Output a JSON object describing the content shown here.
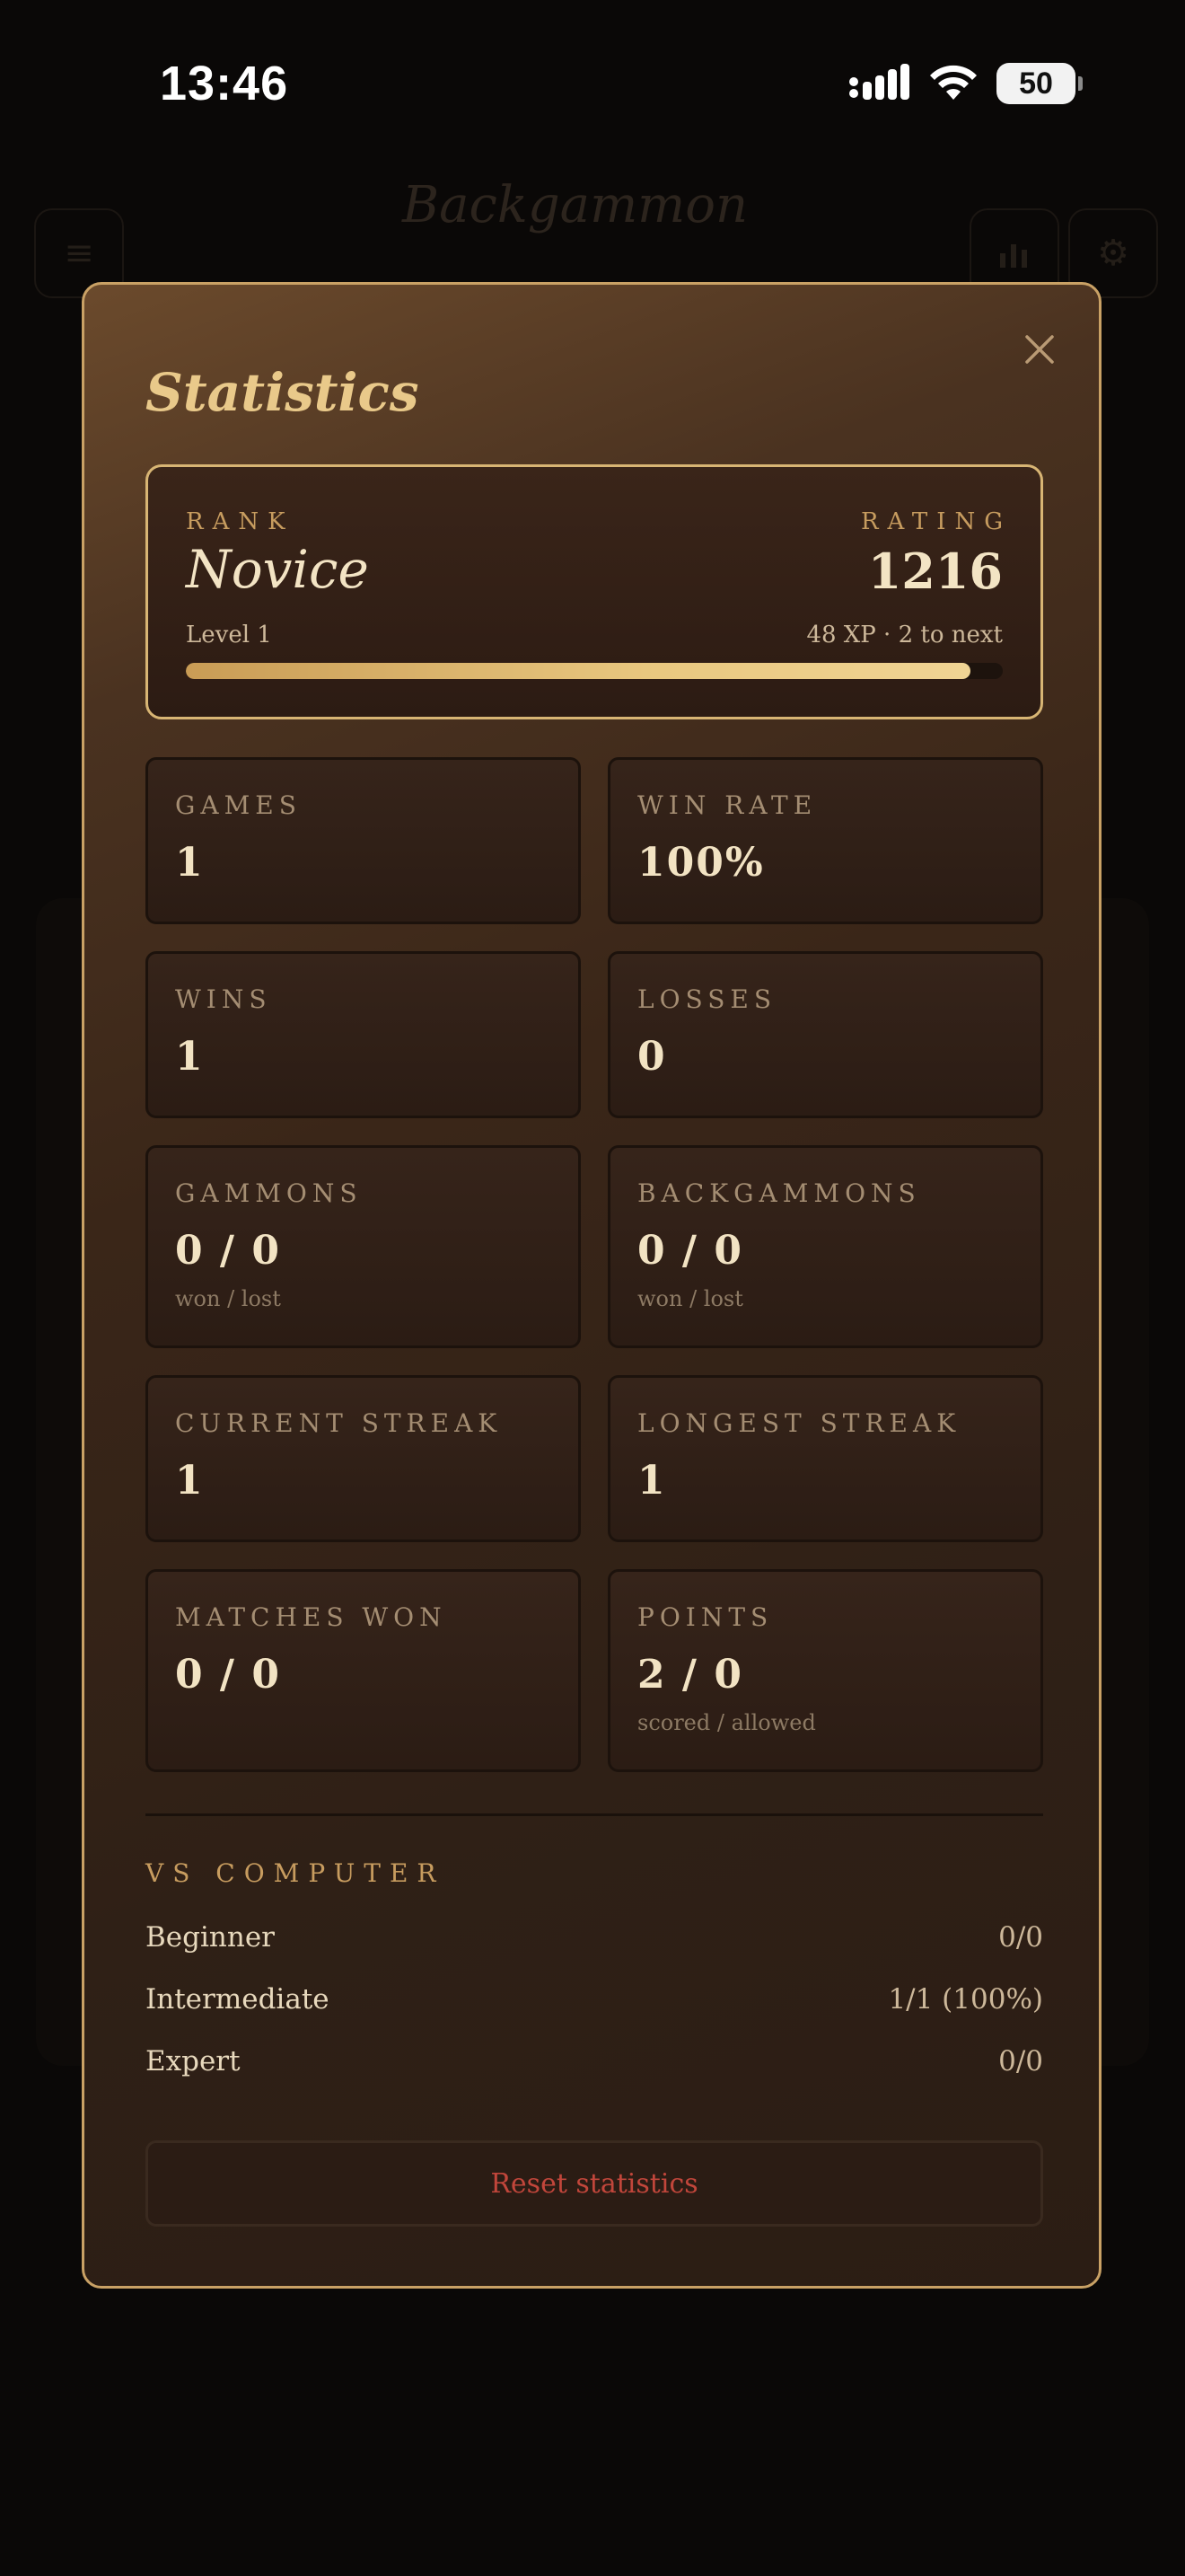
{
  "status_bar": {
    "time": "13:46",
    "battery": "50"
  },
  "background": {
    "title": "Backgammon"
  },
  "modal": {
    "title": "Statistics",
    "rank_card": {
      "rank_label": "RANK",
      "rank": "Novice",
      "rating_label": "RATING",
      "rating": "1216",
      "level": "Level 1",
      "xp_text": "48 XP · 2 to next",
      "progress_fraction": 0.96
    },
    "stats": [
      {
        "label": "GAMES",
        "value": "1",
        "sub": ""
      },
      {
        "label": "WIN RATE",
        "value": "100%",
        "sub": ""
      },
      {
        "label": "WINS",
        "value": "1",
        "sub": ""
      },
      {
        "label": "LOSSES",
        "value": "0",
        "sub": ""
      },
      {
        "label": "GAMMONS",
        "value": "0 / 0",
        "sub": "won / lost"
      },
      {
        "label": "BACKGAMMONS",
        "value": "0 / 0",
        "sub": "won / lost"
      },
      {
        "label": "CURRENT STREAK",
        "value": "1",
        "sub": ""
      },
      {
        "label": "LONGEST STREAK",
        "value": "1",
        "sub": ""
      },
      {
        "label": "MATCHES WON",
        "value": "0 / 0",
        "sub": ""
      },
      {
        "label": "POINTS",
        "value": "2 / 0",
        "sub": "scored / allowed"
      }
    ],
    "vs_computer": {
      "label": "VS COMPUTER",
      "rows": [
        {
          "name": "Beginner",
          "value": "0/0"
        },
        {
          "name": "Intermediate",
          "value": "1/1 (100%)"
        },
        {
          "name": "Expert",
          "value": "0/0"
        }
      ]
    },
    "reset_label": "Reset statistics"
  },
  "colors": {
    "accent": "#c9a165",
    "danger": "#c1463b",
    "panel": "#2b1c14"
  },
  "icons": {
    "close": "close-icon",
    "menu": "menu-icon",
    "chart": "chart-icon",
    "settings": "gear-icon"
  }
}
